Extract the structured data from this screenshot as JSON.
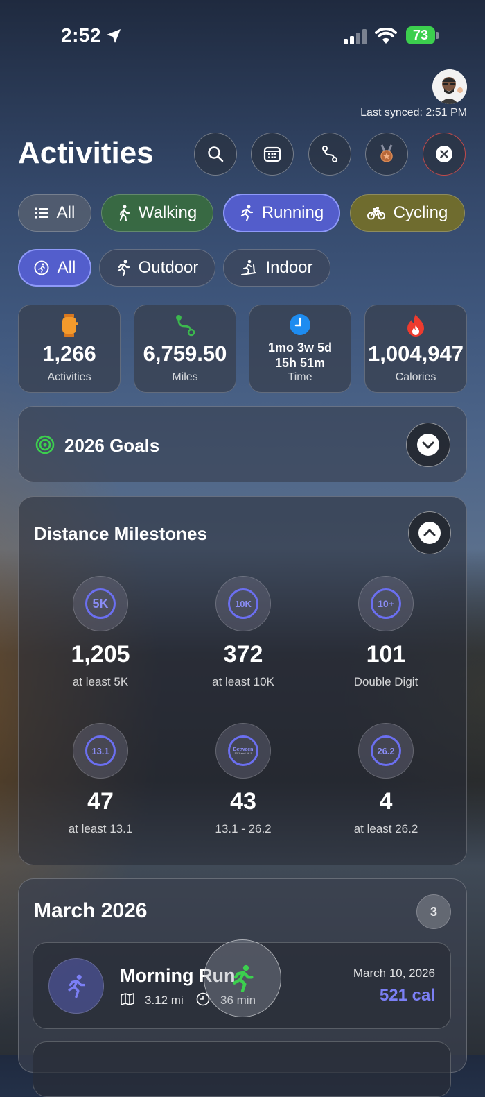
{
  "status_bar": {
    "time": "2:52",
    "battery": "73"
  },
  "header": {
    "last_synced": "Last synced: 2:51 PM",
    "title": "Activities"
  },
  "activity_filters": [
    "All",
    "Walking",
    "Running",
    "Cycling"
  ],
  "location_filters": [
    "All",
    "Outdoor",
    "Indoor"
  ],
  "stats": [
    {
      "value": "1,266",
      "label": "Activities"
    },
    {
      "value": "6,759.50",
      "label": "Miles"
    },
    {
      "value_line1": "1mo 3w 5d",
      "value_line2": "15h 51m",
      "label": "Time"
    },
    {
      "value": "1,004,947",
      "label": "Calories"
    }
  ],
  "goals": {
    "title": "2026 Goals"
  },
  "milestones": {
    "title": "Distance Milestones",
    "items": [
      {
        "badge": "5K",
        "value": "1,205",
        "label": "at least 5K"
      },
      {
        "badge": "10K",
        "value": "372",
        "label": "at least 10K"
      },
      {
        "badge": "10+",
        "value": "101",
        "label": "Double Digit"
      },
      {
        "badge": "13.1",
        "value": "47",
        "label": "at least 13.1"
      },
      {
        "badge": "Between",
        "badge_sub": "13.1 and 26.2",
        "value": "43",
        "label": "13.1 - 26.2"
      },
      {
        "badge": "26.2",
        "value": "4",
        "label": "at least 26.2"
      }
    ]
  },
  "month_section": {
    "title": "March 2026",
    "count": "3",
    "activity": {
      "name": "Morning Run",
      "distance": "3.12 mi",
      "duration": "36 min",
      "date": "March 10, 2026",
      "calories": "521 cal"
    }
  },
  "colors": {
    "accent": "#6b6ff0",
    "calories": "#7b7ff5",
    "running_green": "#3ccf4e"
  },
  "icons": [
    "location-arrow-icon",
    "signal-icon",
    "wifi-icon",
    "search-icon",
    "calendar-icon",
    "route-icon",
    "medal-icon",
    "close-icon",
    "list-icon",
    "walking-icon",
    "running-icon",
    "bicycle-icon",
    "watch-icon",
    "clock-icon",
    "flame-icon",
    "target-icon",
    "chevron-down-icon",
    "chevron-up-icon",
    "map-icon"
  ]
}
